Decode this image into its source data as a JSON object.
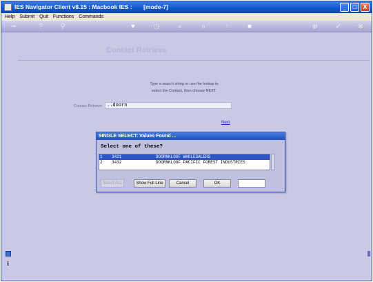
{
  "window": {
    "title": "IES Navigator Client v8.15 : Macbook IES :       [mode-7]",
    "minimize": "_",
    "maximize": "□",
    "close": "X"
  },
  "menu": [
    "Help",
    "Submit",
    "Quit",
    "Functions",
    "Commands"
  ],
  "toolbar": {
    "icons": [
      {
        "name": "key-icon",
        "glyph": "⊸"
      },
      {
        "name": "help-icon",
        "glyph": "?"
      },
      {
        "name": "search-icon",
        "glyph": "⚲"
      },
      {
        "name": "heart-icon",
        "glyph": "♥"
      },
      {
        "name": "clock-icon",
        "glyph": "◷"
      },
      {
        "name": "back-icon",
        "glyph": "«"
      },
      {
        "name": "forward-icon",
        "glyph": "»"
      },
      {
        "name": "up-icon",
        "glyph": "↑"
      },
      {
        "name": "stop-icon",
        "glyph": "■"
      },
      {
        "name": "globe-icon",
        "glyph": "⊕"
      },
      {
        "name": "check-icon",
        "glyph": "✓"
      },
      {
        "name": "cancel-icon",
        "glyph": "⊗"
      }
    ]
  },
  "page": {
    "title": "Contact Retrieve",
    "instruction_line1": "Type a search string or use the lookup to",
    "instruction_line2": "select the Contact, then choose NEXT.",
    "field_label": "Contact Retrieve",
    "field_value": "..doorn",
    "next_link": "Next"
  },
  "dialog": {
    "title": "SINGLE SELECT: Values Found ...",
    "prompt": "Select one of these?",
    "rows": [
      {
        "index": "1",
        "code": "3421",
        "name": "DOORNKLOOF WHOLESALERS",
        "selected": true
      },
      {
        "index": "2",
        "code": "3432",
        "name": "DOORNKLOOF PACIFIC FOREST INDUSTRIES",
        "selected": false
      }
    ],
    "buttons": {
      "select_all": "Select ALL",
      "show_full_line": "Show Full Line",
      "cancel": "Cancel",
      "ok": "OK"
    }
  },
  "colors": {
    "background": "#c9c9e6",
    "title_bar": "#1456c9",
    "selection": "#2d55c4"
  }
}
